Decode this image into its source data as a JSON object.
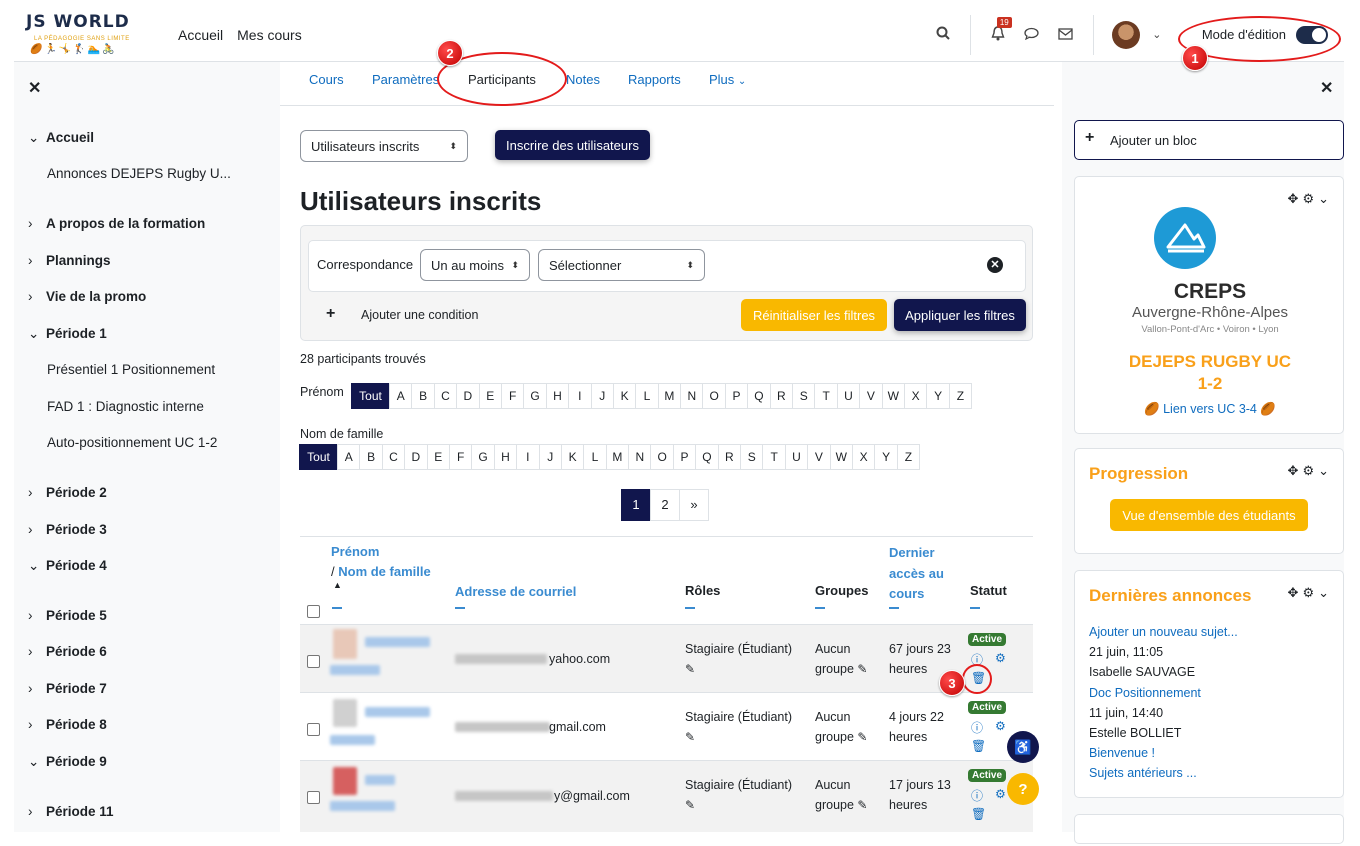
{
  "logo": {
    "title": "JS WORLD",
    "tagline": "LA PÉDAGOGIE SANS LIMITE"
  },
  "topnav": {
    "home": "Accueil",
    "my_courses": "Mes cours",
    "notifications_count": "19",
    "edit_mode": "Mode d'édition"
  },
  "tabs": [
    "Cours",
    "Paramètres",
    "Participants",
    "Notes",
    "Rapports",
    "Plus"
  ],
  "sidebar": {
    "items": [
      {
        "label": "Accueil",
        "chev": "⌄"
      },
      {
        "label": "Annonces DEJEPS Rugby U..."
      },
      {
        "label": "A propos de la formation",
        "chev": "›"
      },
      {
        "label": "Plannings",
        "chev": "›"
      },
      {
        "label": "Vie de la promo",
        "chev": "›"
      },
      {
        "label": "Période 1",
        "chev": "⌄"
      },
      {
        "label": "Présentiel 1 Positionnement"
      },
      {
        "label": "FAD 1 : Diagnostic interne"
      },
      {
        "label": "Auto-positionnement UC 1-2"
      },
      {
        "label": "Période 2",
        "chev": "›"
      },
      {
        "label": "Période 3",
        "chev": "›"
      },
      {
        "label": "Période 4",
        "chev": "⌄"
      },
      {
        "label": "Période 5",
        "chev": "›"
      },
      {
        "label": "Période 6",
        "chev": "›"
      },
      {
        "label": "Période 7",
        "chev": "›"
      },
      {
        "label": "Période 8",
        "chev": "›"
      },
      {
        "label": "Période 9",
        "chev": "⌄"
      },
      {
        "label": "Période 11",
        "chev": "›"
      }
    ]
  },
  "main": {
    "enrol_select": "Utilisateurs inscrits",
    "enrol_button": "Inscrire des utilisateurs",
    "title": "Utilisateurs inscrits",
    "filter": {
      "match_label": "Correspondance",
      "match_value": "Un au moins",
      "select_value": "Sélectionner",
      "add_condition": "Ajouter une condition",
      "reset": "Réinitialiser les filtres",
      "apply": "Appliquer les filtres"
    },
    "found": "28 participants trouvés",
    "firstname_label": "Prénom",
    "lastname_label": "Nom de famille",
    "letters": [
      "Tout",
      "A",
      "B",
      "C",
      "D",
      "E",
      "F",
      "G",
      "H",
      "I",
      "J",
      "K",
      "L",
      "M",
      "N",
      "O",
      "P",
      "Q",
      "R",
      "S",
      "T",
      "U",
      "V",
      "W",
      "X",
      "Y",
      "Z"
    ],
    "pages": [
      "1",
      "2",
      "»"
    ],
    "columns": {
      "firstname": "Prénom",
      "lastname": "Nom de famille",
      "email": "Adresse de courriel",
      "roles": "Rôles",
      "groups": "Groupes",
      "last_access_1": "Dernier",
      "last_access_2": "accès au",
      "last_access_3": "cours",
      "status": "Statut"
    },
    "rows": [
      {
        "email": "yahoo.com",
        "role": "Stagiaire (Étudiant)",
        "group_1": "Aucun",
        "group_2": "groupe",
        "access_1": "67 jours 23",
        "access_2": "heures",
        "status": "Active"
      },
      {
        "email": "gmail.com",
        "role": "Stagiaire (Étudiant)",
        "group_1": "Aucun",
        "group_2": "groupe",
        "access_1": "4 jours 22",
        "access_2": "heures",
        "status": "Active"
      },
      {
        "email": "y@gmail.com",
        "role": "Stagiaire (Étudiant)",
        "group_1": "Aucun",
        "group_2": "groupe",
        "access_1": "17 jours 13",
        "access_2": "heures",
        "status": "Active"
      }
    ]
  },
  "right": {
    "add_block": "Ajouter un bloc",
    "creps": {
      "name": "CREPS",
      "region": "Auvergne-Rhône-Alpes",
      "sites": "Vallon-Pont-d'Arc  •  Voiron  •  Lyon",
      "course_1": "DEJEPS RUGBY UC",
      "course_2": "1-2",
      "link": "Lien vers UC 3-4"
    },
    "progress": {
      "title": "Progression",
      "button": "Vue d'ensemble des étudiants"
    },
    "news": {
      "title": "Dernières annonces",
      "add": "Ajouter un nouveau sujet...",
      "d1": "21 juin, 11:05",
      "a1": "Isabelle SAUVAGE",
      "t1": "Doc Positionnement",
      "d2": "11 juin, 14:40",
      "a2": "Estelle BOLLIET",
      "t2": "Bienvenue !",
      "older": "Sujets antérieurs ..."
    }
  },
  "annotations": [
    "1",
    "2",
    "3"
  ],
  "colors": {
    "primary": "#11164d",
    "accent": "#f9a01a",
    "link": "#0f6cbf",
    "active": "#357a32",
    "annotation": "#e31b1b"
  }
}
